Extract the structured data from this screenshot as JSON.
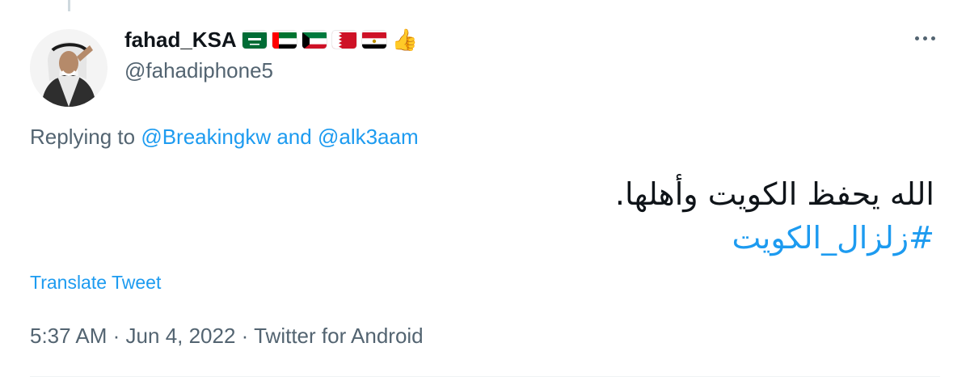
{
  "tweet": {
    "display_name": "fahad_KSA",
    "flags": [
      "saudi-arabia-flag",
      "uae-flag",
      "kuwait-flag",
      "bahrain-flag",
      "egypt-flag"
    ],
    "emoji": "👍",
    "handle": "@fahadiphone5",
    "replying_prefix": "Replying to",
    "reply_to_1": "@Breakingkw",
    "reply_joiner": "and",
    "reply_to_2": "@alk3aam",
    "text": "الله يحفظ الكويت وأهلها.",
    "hashtag": "#زلزال_الكويت",
    "translate_label": "Translate Tweet",
    "time": "5:37 AM",
    "separator": "·",
    "date": "Jun 4, 2022",
    "source": "Twitter for Android"
  },
  "colors": {
    "link": "#1d9bf0",
    "secondary_text": "#536471",
    "primary_text": "#0f1419"
  }
}
